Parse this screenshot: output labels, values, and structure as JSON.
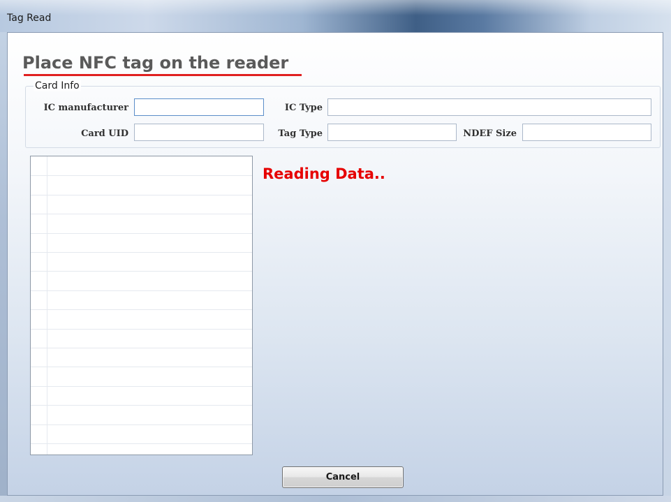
{
  "window": {
    "title": "Tag Read"
  },
  "heading": "Place NFC tag on the reader",
  "card_info": {
    "legend": "Card Info",
    "fields": {
      "ic_manufacturer": {
        "label": "IC manufacturer",
        "value": ""
      },
      "ic_type": {
        "label": "IC Type",
        "value": ""
      },
      "card_uid": {
        "label": "Card UID",
        "value": ""
      },
      "tag_type": {
        "label": "Tag Type",
        "value": ""
      },
      "ndef_size": {
        "label": "NDEF Size",
        "value": ""
      }
    }
  },
  "status": "Reading Data..",
  "data_list": {
    "rows": []
  },
  "buttons": {
    "cancel": "Cancel"
  },
  "colors": {
    "accent_red": "#e60000",
    "underline_red": "#e02020"
  }
}
